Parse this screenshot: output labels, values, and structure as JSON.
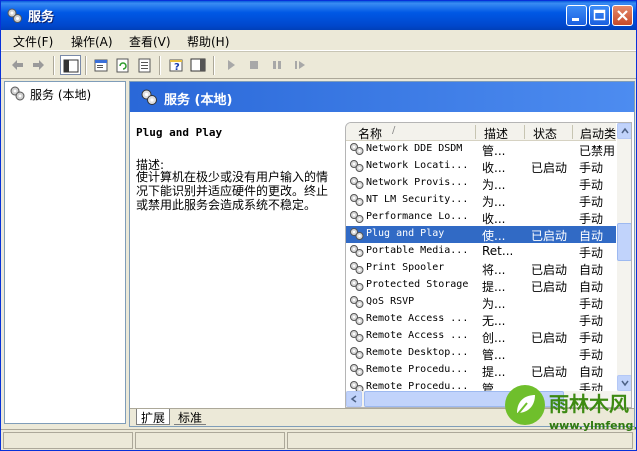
{
  "window": {
    "title": "服务"
  },
  "menu": [
    "文件(F)",
    "操作(A)",
    "查看(V)",
    "帮助(H)"
  ],
  "tree": {
    "root_label": "服务 (本地)"
  },
  "panel": {
    "header_title": "服务 (本地)"
  },
  "description": {
    "service_name": "Plug and Play",
    "label": "描述:",
    "text": "使计算机在极少或没有用户输入的情况下能识别并适应硬件的更改。终止或禁用此服务会造成系统不稳定。"
  },
  "list": {
    "columns": [
      "名称",
      "描述",
      "状态",
      "启动类"
    ],
    "rows": [
      {
        "name": "Network DDE DSDM",
        "desc": "管...",
        "status": "",
        "startup": "已禁用",
        "selected": false
      },
      {
        "name": "Network Locati...",
        "desc": "收...",
        "status": "已启动",
        "startup": "手动",
        "selected": false
      },
      {
        "name": "Network Provis...",
        "desc": "为...",
        "status": "",
        "startup": "手动",
        "selected": false
      },
      {
        "name": "NT LM Security...",
        "desc": "为...",
        "status": "",
        "startup": "手动",
        "selected": false
      },
      {
        "name": "Performance Lo...",
        "desc": "收...",
        "status": "",
        "startup": "手动",
        "selected": false
      },
      {
        "name": "Plug and Play",
        "desc": "使...",
        "status": "已启动",
        "startup": "自动",
        "selected": true
      },
      {
        "name": "Portable Media...",
        "desc": "Ret...",
        "status": "",
        "startup": "手动",
        "selected": false
      },
      {
        "name": "Print Spooler",
        "desc": "将...",
        "status": "已启动",
        "startup": "自动",
        "selected": false
      },
      {
        "name": "Protected Storage",
        "desc": "提...",
        "status": "已启动",
        "startup": "自动",
        "selected": false
      },
      {
        "name": "QoS RSVP",
        "desc": "为...",
        "status": "",
        "startup": "手动",
        "selected": false
      },
      {
        "name": "Remote Access ...",
        "desc": "无...",
        "status": "",
        "startup": "手动",
        "selected": false
      },
      {
        "name": "Remote Access ...",
        "desc": "创...",
        "status": "已启动",
        "startup": "手动",
        "selected": false
      },
      {
        "name": "Remote Desktop...",
        "desc": "管...",
        "status": "",
        "startup": "手动",
        "selected": false
      },
      {
        "name": "Remote Procedu...",
        "desc": "提...",
        "status": "已启动",
        "startup": "自动",
        "selected": false
      },
      {
        "name": "Remote Procedu...",
        "desc": "管...",
        "status": "",
        "startup": "手动",
        "selected": false
      }
    ]
  },
  "tabs": [
    "扩展",
    "标准"
  ],
  "watermark": {
    "name": "雨林木风",
    "url": "www.ylmfeng.com"
  },
  "colors": {
    "title_bar": "#0058e5",
    "panel_header": "#2a68d8",
    "selection": "#316ac5",
    "watermark_green": "#3d8a12"
  }
}
